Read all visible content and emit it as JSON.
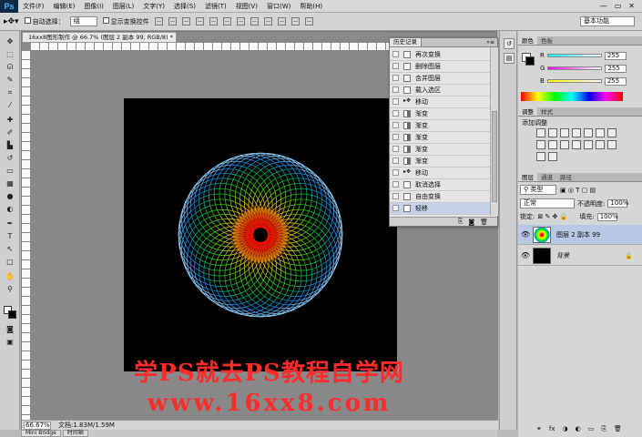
{
  "app": {
    "logo": "Ps"
  },
  "menubar": {
    "items": [
      "文件(F)",
      "编辑(E)",
      "图像(I)",
      "图层(L)",
      "文字(Y)",
      "选择(S)",
      "滤镜(T)",
      "视图(V)",
      "窗口(W)",
      "帮助(H)"
    ]
  },
  "window_controls": {
    "minimize": "—",
    "restore": "▭",
    "close": "✕"
  },
  "options_bar": {
    "tool_icon": "move-tool-icon",
    "auto_select_label": "自动选择：",
    "auto_select_value": "组",
    "show_transform_label": "显示变换控件",
    "workspace": "基本功能"
  },
  "document": {
    "tab_title": "16xx8图形制作 @ 66.7% (图层 2 副本 99, RGB/8) *",
    "zoom": "66.67%",
    "doc_info": "文档:1.83M/1.59M"
  },
  "watermark": {
    "line1": "学PS就去PS教程自学网",
    "line2": "www.16xx8.com"
  },
  "bottom_tabs": [
    "Mini Bridge",
    "时间轴"
  ],
  "history_panel": {
    "title": "历史记录",
    "items": [
      {
        "label": "再次变换",
        "icon": "doc"
      },
      {
        "label": "删除图层",
        "icon": "doc"
      },
      {
        "label": "合并图层",
        "icon": "doc"
      },
      {
        "label": "载入选区",
        "icon": "doc"
      },
      {
        "label": "移动",
        "icon": "move"
      },
      {
        "label": "渐变",
        "icon": "gradient"
      },
      {
        "label": "渐变",
        "icon": "gradient"
      },
      {
        "label": "渐变",
        "icon": "gradient"
      },
      {
        "label": "渐变",
        "icon": "gradient"
      },
      {
        "label": "渐变",
        "icon": "gradient"
      },
      {
        "label": "移动",
        "icon": "move"
      },
      {
        "label": "取消选择",
        "icon": "doc"
      },
      {
        "label": "自由变换",
        "icon": "doc"
      },
      {
        "label": "轻移",
        "icon": "doc",
        "active": true
      }
    ]
  },
  "color_panel": {
    "tabs": [
      "颜色",
      "色板"
    ],
    "channels": [
      {
        "label": "R",
        "value": "255"
      },
      {
        "label": "G",
        "value": "255"
      },
      {
        "label": "B",
        "value": "255"
      }
    ]
  },
  "adjust_panel": {
    "tabs": [
      "调整",
      "样式"
    ],
    "title": "添加调整"
  },
  "layers_panel": {
    "tabs": [
      "图层",
      "通道",
      "路径"
    ],
    "kind_filter": "类型",
    "blend_mode": "正常",
    "opacity_label": "不透明度:",
    "opacity_value": "100%",
    "lock_label": "锁定:",
    "fill_label": "填充:",
    "fill_value": "100%",
    "layers": [
      {
        "name": "图层 2 副本 99",
        "active": true
      },
      {
        "name": "背景",
        "active": false,
        "locked": true
      }
    ]
  }
}
